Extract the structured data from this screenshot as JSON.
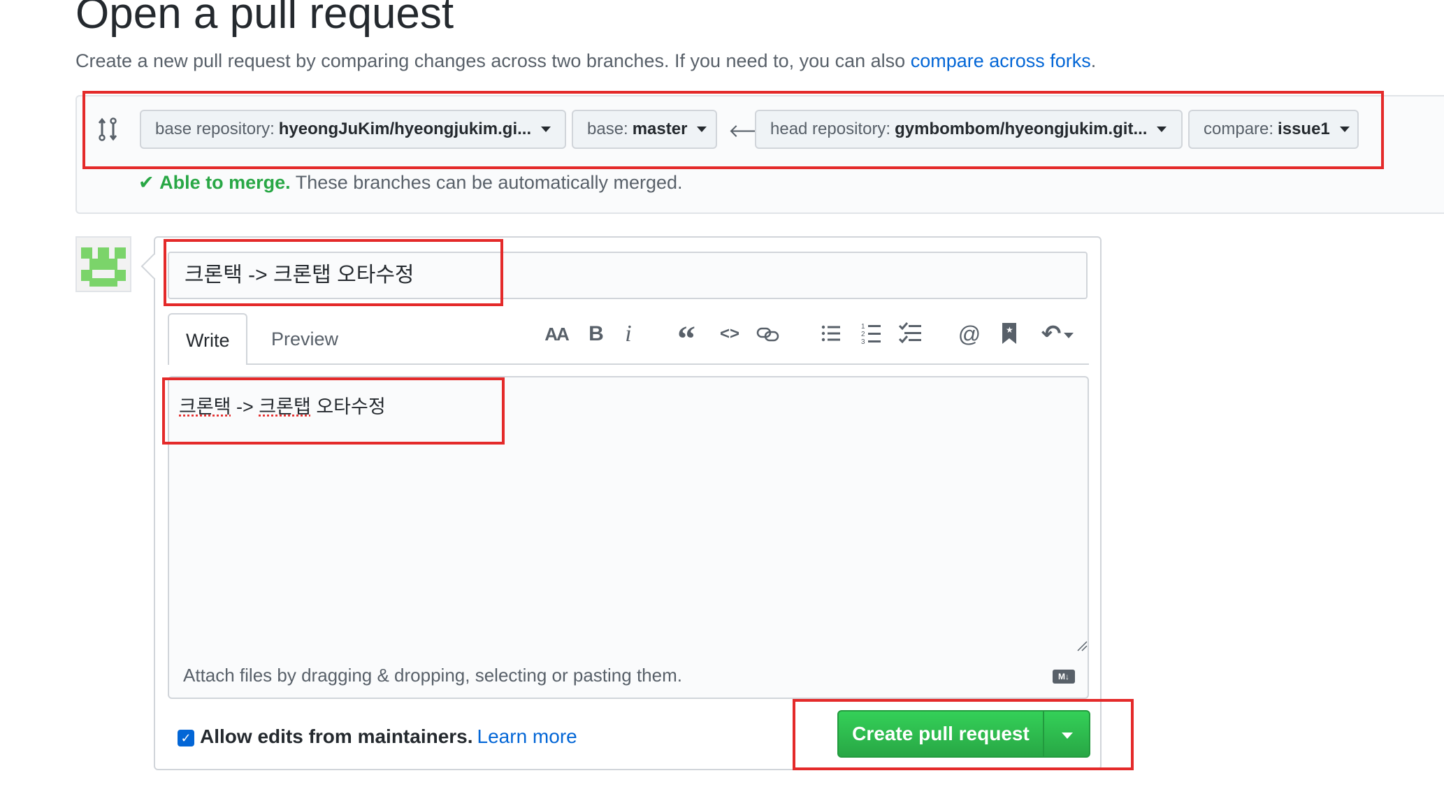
{
  "page": {
    "title": "Open a pull request",
    "subtitle_text": "Create a new pull request by comparing changes across two branches. If you need to, you can also ",
    "subtitle_link": "compare across forks",
    "subtitle_end": "."
  },
  "range": {
    "base_repo_label": "base repository:",
    "base_repo_value": "hyeongJuKim/hyeongjukim.gi...",
    "base_label": "base:",
    "base_value": "master",
    "head_repo_label": "head repository:",
    "head_repo_value": "gymbombom/hyeongjukim.git...",
    "compare_label": "compare:",
    "compare_value": "issue1",
    "merge_ok": "Able to merge.",
    "merge_text": "These branches can be automatically merged."
  },
  "form": {
    "title_value": "크론택 -> 크론탭 오타수정",
    "tabs": [
      "Write",
      "Preview"
    ],
    "toolbar": {
      "heading": "AA",
      "bold": "B",
      "italic": "i",
      "quote": "“",
      "code": "<>",
      "link": "∞",
      "ul": "☰",
      "ol": "☰",
      "task": "☑",
      "mention": "@",
      "reference": "⚑",
      "reply": "↶"
    },
    "body_word1": "크론택",
    "body_arrow": " -> ",
    "body_word2": "크론탭",
    "body_rest": " 오타수정",
    "attach_text": "Attach files by dragging & dropping, selecting or pasting them.",
    "markdown_badge": "M↓"
  },
  "footer": {
    "allow_edits_label": "Allow edits from maintainers.",
    "learn_more": "Learn more",
    "create_button": "Create pull request"
  },
  "colors": {
    "accent_green": "#28a745",
    "link_blue": "#0366d6",
    "annotation_red": "#e42a2a"
  }
}
